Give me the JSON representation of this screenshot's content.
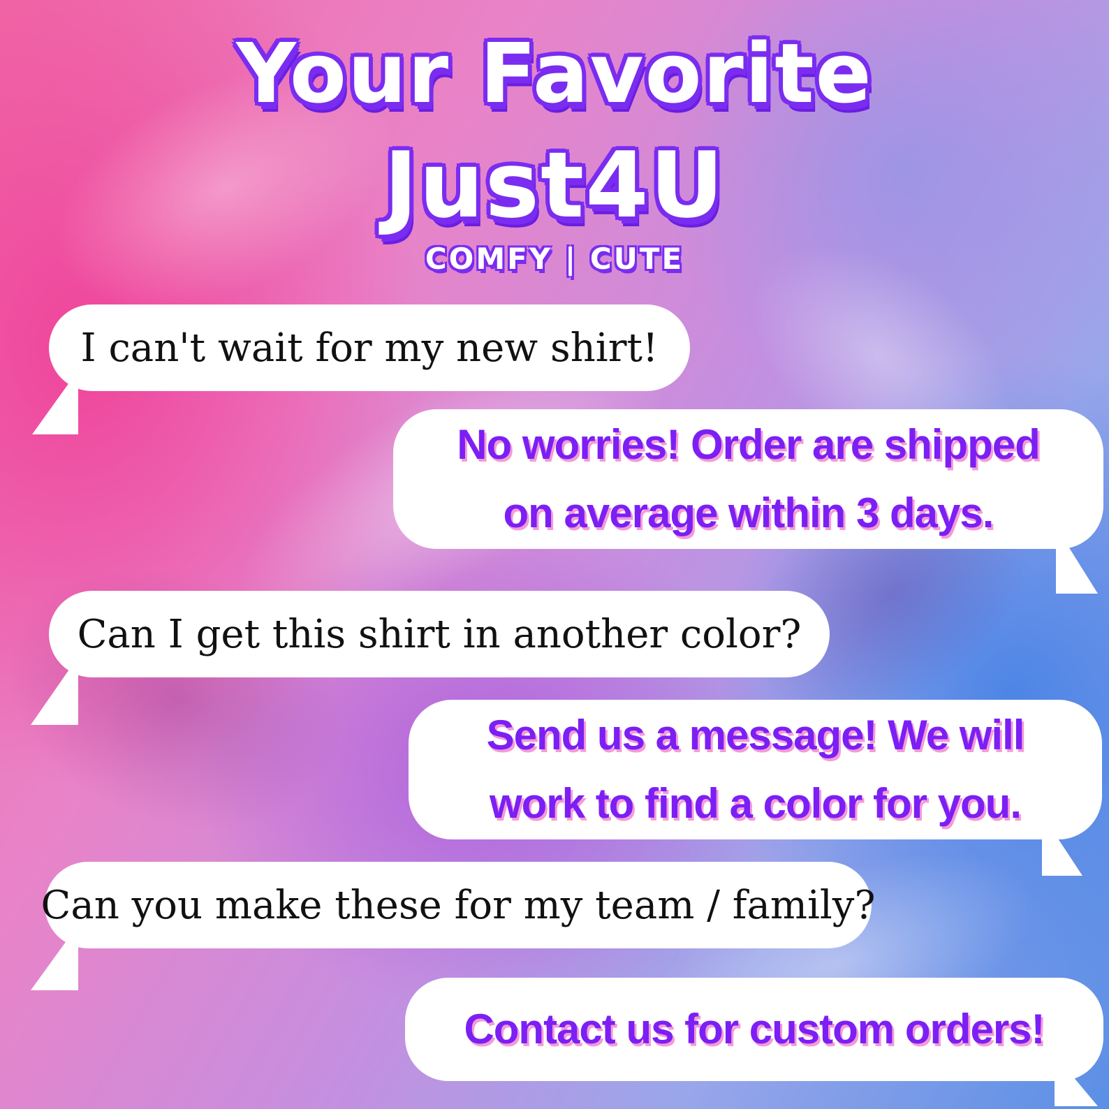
{
  "header": {
    "title_line1": "Your Favorite",
    "title_line2": "Just4U",
    "tagline": "COMFY | CUTE"
  },
  "chat": {
    "q1": "I can't wait for my new shirt!",
    "a1_line1": "No worries! Order are shipped",
    "a1_line2": "on average within 3 days.",
    "q2": "Can I get this shirt in another color?",
    "a2_line1": "Send us a message! We will",
    "a2_line2": "work to find a color for you.",
    "q3": "Can you make these for my team / family?",
    "a3": "Contact us for custom orders!"
  },
  "colors": {
    "accent_purple": "#7b1ff5",
    "shadow_pink": "#f59ad6",
    "bubble_white": "#ffffff"
  }
}
